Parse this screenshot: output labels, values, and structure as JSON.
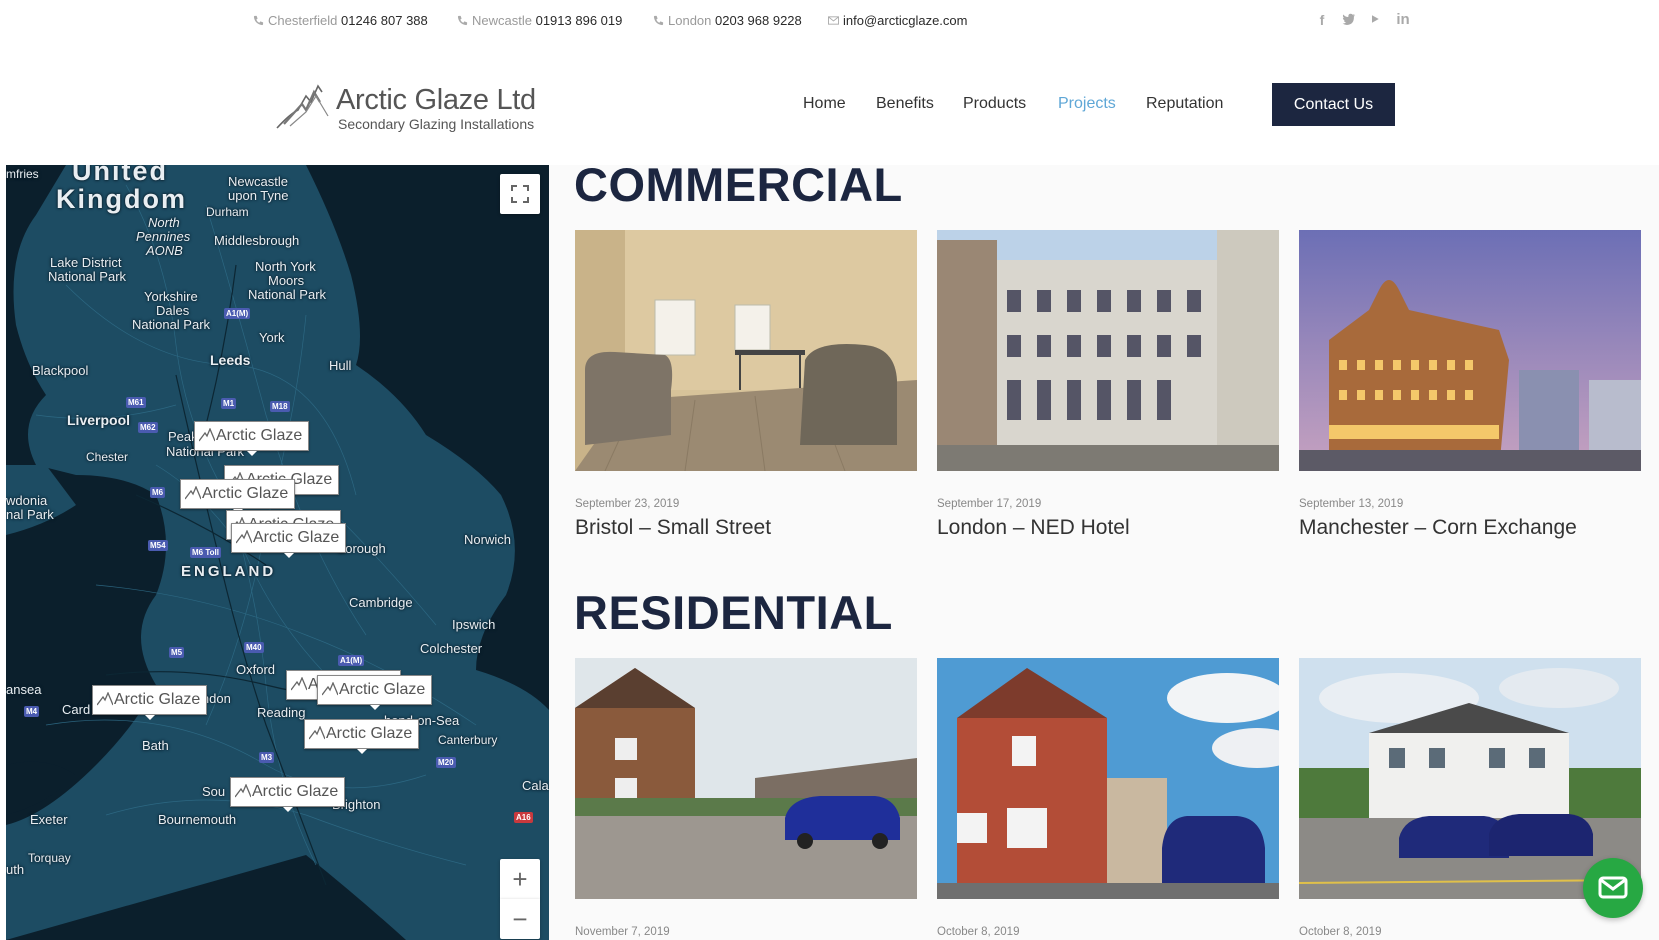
{
  "topbar": {
    "contacts": [
      {
        "city": "Chesterfield",
        "number": "01246 807 388"
      },
      {
        "city": "Newcastle",
        "number": "01913 896 019"
      },
      {
        "city": "London",
        "number": "0203 968 9228"
      }
    ],
    "email": "info@arcticglaze.com",
    "social": [
      "facebook-icon",
      "twitter-icon",
      "youtube-icon",
      "linkedin-icon"
    ]
  },
  "brand": {
    "name": "Arctic Glaze Ltd",
    "tagline": "Secondary Glazing Installations"
  },
  "nav": {
    "items": [
      "Home",
      "Benefits",
      "Products",
      "Projects",
      "Reputation"
    ],
    "active": "Projects",
    "cta": "Contact Us"
  },
  "map": {
    "labels": {
      "united": "United",
      "kingdom": "Kingdom",
      "mfries": "mfries",
      "newcastle": "Newcastle",
      "upon_tyne": "upon Tyne",
      "durham": "Durham",
      "north_pennines_1": "North",
      "north_pennines_2": "Pennines",
      "north_pennines_3": "AONB",
      "middlesbrough": "Middlesbrough",
      "lake_district_1": "Lake District",
      "lake_district_2": "National Park",
      "north_york_1": "North York",
      "north_york_2": "Moors",
      "north_york_3": "National Park",
      "yorkshire_1": "Yorkshire",
      "yorkshire_2": "Dales",
      "yorkshire_3": "National Park",
      "york": "York",
      "leeds": "Leeds",
      "hull": "Hull",
      "blackpool": "Blackpool",
      "liverpool": "Liverpool",
      "peak": "Peak",
      "national_park": "National Park",
      "chester": "Chester",
      "wdonia": "wdonia",
      "nal_park": "nal Park",
      "borough": "borough",
      "norwich": "Norwich",
      "england": "ENGLAND",
      "cambridge": "Cambridge",
      "ipswich": "Ipswich",
      "colchester": "Colchester",
      "oxford": "Oxford",
      "ansea": "ansea",
      "card": "Card",
      "indon": "indon",
      "reading": "Reading",
      "southend": "hend-on-Sea",
      "canterbury": "Canterbury",
      "bath": "Bath",
      "sou": "Sou",
      "brighton": "Brighton",
      "cala": "Cala",
      "exeter": "Exeter",
      "bournemouth": "Bournemouth",
      "torquay": "Torquay",
      "uth": "uth"
    },
    "roads": [
      "A1(M)",
      "M61",
      "M1",
      "M18",
      "M62",
      "M6",
      "M54",
      "M6 Toll",
      "M5",
      "M40",
      "A1(M)",
      "M4",
      "M3",
      "M20",
      "A16"
    ],
    "pin_label": "Arctic Glaze"
  },
  "sections": [
    {
      "title": "COMMERCIAL",
      "cards": [
        {
          "date": "September 23, 2019",
          "title": "Bristol – Small Street"
        },
        {
          "date": "September 17, 2019",
          "title": "London – NED Hotel"
        },
        {
          "date": "September 13, 2019",
          "title": "Manchester – Corn Exchange"
        }
      ]
    },
    {
      "title": "RESIDENTIAL",
      "cards": [
        {
          "date": "November 7, 2019",
          "title": ""
        },
        {
          "date": "October 8, 2019",
          "title": ""
        },
        {
          "date": "October 8, 2019",
          "title": ""
        }
      ]
    }
  ],
  "colors": {
    "navy": "#1c2640",
    "link_active": "#5fa7d6",
    "chat_green": "#27a843",
    "map_bg": "#0b1f2c"
  }
}
